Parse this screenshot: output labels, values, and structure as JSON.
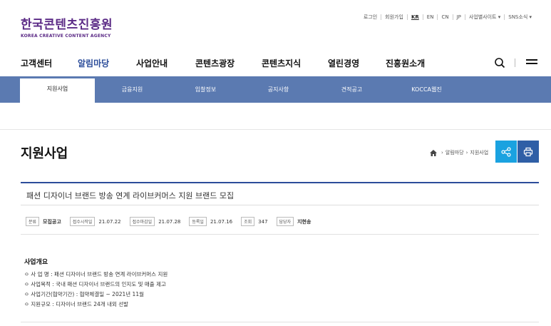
{
  "utility_links": [
    "로그인",
    "회원가입",
    "KR",
    "EN",
    "CN",
    "JP",
    "사업별사이트 ▾",
    "SNS소식 ▾"
  ],
  "utility_active": "KR",
  "logo": {
    "ko": "한국콘텐츠진흥원",
    "en": "KOREA CREATIVE CONTENT AGENCY",
    "color": "#5b2a86"
  },
  "gnb": [
    {
      "label": "고객센터",
      "active": false
    },
    {
      "label": "알림마당",
      "active": true
    },
    {
      "label": "사업안내",
      "active": false
    },
    {
      "label": "콘텐츠광장",
      "active": false
    },
    {
      "label": "콘텐츠지식",
      "active": false
    },
    {
      "label": "열린경영",
      "active": false
    },
    {
      "label": "진흥원소개",
      "active": false
    }
  ],
  "subnav": [
    {
      "label": "지원사업",
      "active": true
    },
    {
      "label": "금융지원",
      "active": false
    },
    {
      "label": "입찰정보",
      "active": false
    },
    {
      "label": "공지사항",
      "active": false
    },
    {
      "label": "견적공고",
      "active": false
    },
    {
      "label": "KOCCA웹진",
      "active": false
    }
  ],
  "page_title": "지원사업",
  "breadcrumb": [
    "알림마당",
    "지원사업"
  ],
  "post": {
    "title": "패션 디자이너 브랜드 방송 연계 라이브커머스 지원 브랜드 모집",
    "meta": [
      {
        "label": "분류",
        "value": "모집공고",
        "bold": true
      },
      {
        "label": "접수시작일",
        "value": "21.07.22",
        "bold": false
      },
      {
        "label": "접수마감일",
        "value": "21.07.28",
        "bold": false
      },
      {
        "label": "등록일",
        "value": "21.07.16",
        "bold": false
      },
      {
        "label": "조회",
        "value": "347",
        "bold": false
      },
      {
        "label": "담당자",
        "value": "지현송",
        "bold": true
      }
    ],
    "section_title": "사업개요",
    "lines": [
      "ㅇ 사 업 명 : 패션 디자이너 브랜드 방송 연계 라이브커머스 지원",
      "ㅇ 사업목적 : 국내 패션 디자이너 브랜드의 인지도 및 매출 제고",
      "ㅇ 사업기간(협약기간) : 협약체결일 ~ 2021년 11월",
      "ㅇ 지원규모 : 디자이너 브랜드 24개 내외 선발"
    ]
  },
  "colors": {
    "subnav_bg": "#5b7ab1",
    "accent": "#2c4d9a",
    "share": "#1aa2e0",
    "print": "#2f5fa6"
  },
  "icons": [
    "search-icon",
    "menu-icon",
    "home-icon",
    "share-icon",
    "print-icon"
  ]
}
